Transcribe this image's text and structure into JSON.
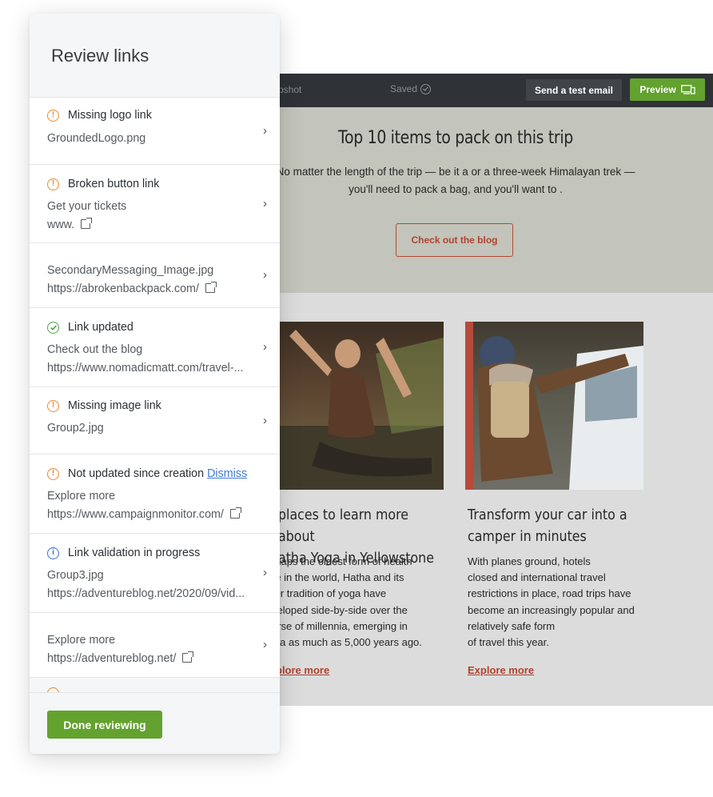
{
  "panel": {
    "title": "Review links",
    "done_label": "Done reviewing",
    "items": [
      {
        "status": "Missing logo link",
        "status_icon": "warning-icon",
        "line1": "GroundedLogo.png"
      },
      {
        "status": "Broken button link",
        "status_icon": "warning-icon",
        "line1": "Get your tickets",
        "line2": "www."
      },
      {
        "line1": "SecondaryMessaging_Image.jpg",
        "line2": "https://abrokenbackpack.com/"
      },
      {
        "status": "Link updated",
        "status_icon": "check-icon",
        "line1": "Check out the blog",
        "line2": "https://www.nomadicmatt.com/travel-..."
      },
      {
        "status": "Missing image link",
        "status_icon": "warning-icon",
        "line1": "Group2.jpg"
      },
      {
        "status": "Not updated since creation",
        "status_icon": "warning-icon",
        "dismiss": "Dismiss",
        "line1": "Explore more",
        "line2": "https://www.campaignmonitor.com/"
      },
      {
        "status": "Link validation in progress",
        "status_icon": "info-icon",
        "line1": "Group3.jpg",
        "line2": "https://adventureblog.net/2020/09/vid..."
      },
      {
        "line1": "Explore more",
        "line2": "https://adventureblog.net/"
      }
    ]
  },
  "editor": {
    "toolbar": {
      "snapshot": "pshot",
      "saved": "Saved",
      "test_email": "Send a test email",
      "preview": "Preview"
    },
    "hero": {
      "title": "Top 10 items to pack on this trip",
      "body_line1": "No matter the length of the trip — be it a or a three-week Himalayan trek —",
      "body_line2": "you'll need to pack a bag, and you'll want to .",
      "button": "Check out the blog"
    },
    "card1": {
      "title_line1": "places to learn more about",
      "title_line2": "atha Yoga in Yellowstone",
      "body": [
        "rhaps the oldest form of health",
        "re in the world, Hatha and its",
        "ter tradition of yoga have",
        "veloped side-by-side over the",
        "urse of millennia, emerging in",
        "dia as much as 5,000 years ago."
      ],
      "link": "plore more"
    },
    "card2": {
      "title_line1": "Transform your car into a",
      "title_line2": "camper in minutes",
      "body": [
        "With planes ground, hotels",
        "closed and international travel",
        "restrictions in place, road trips have",
        "become an increasingly popular and",
        "relatively safe form",
        "of travel this year."
      ],
      "link": "Explore more"
    }
  },
  "colors": {
    "accent_green": "#63a22f",
    "warning_orange": "#e8892e",
    "success_green": "#4fa34a",
    "info_blue": "#3a6fd8",
    "link_red": "#b0432e"
  }
}
